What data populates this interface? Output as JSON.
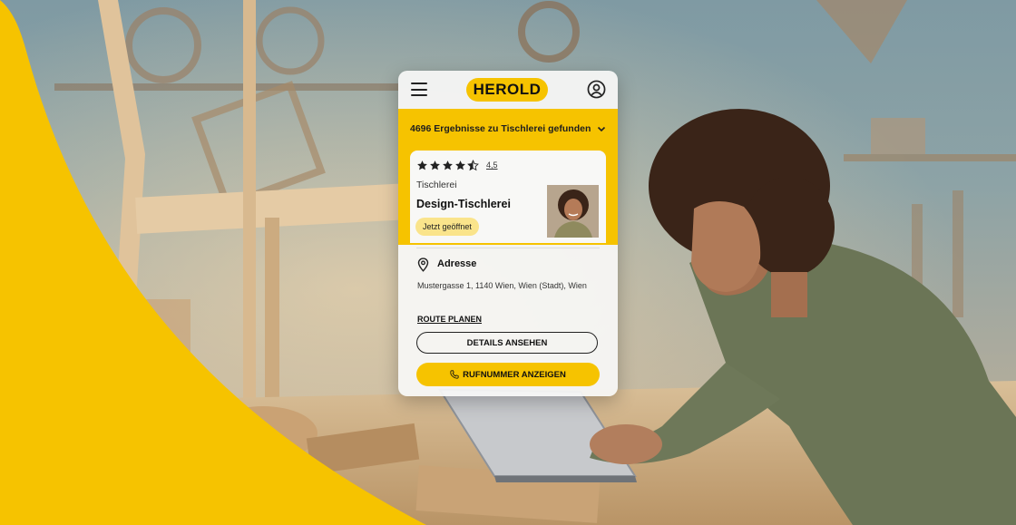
{
  "colors": {
    "brand_yellow": "#f6c300",
    "badge_yellow": "#fae48b",
    "text_dark": "#111111"
  },
  "app": {
    "logo": "HEROLD",
    "menu_icon": "hamburger-menu-icon",
    "profile_icon": "user-profile-icon"
  },
  "search": {
    "results_text": "4696 Ergebnisse zu Tischlerei gefunden",
    "dropdown_icon": "chevron-down-icon"
  },
  "listing": {
    "rating_stars": 4.5,
    "rating_text": "4,5",
    "category": "Tischlerei",
    "name": "Design-Tischlerei",
    "status": "Jetzt geöffnet",
    "address_label": "Adresse",
    "address_icon": "location-pin-icon",
    "address": "Mustergasse 1, 1140 Wien, Wien (Stadt), Wien",
    "route_link": "ROUTE PLANEN",
    "details_button": "DETAILS ANSEHEN",
    "phone_button": "RUFNUMMER ANZEIGEN",
    "phone_icon": "phone-icon"
  }
}
